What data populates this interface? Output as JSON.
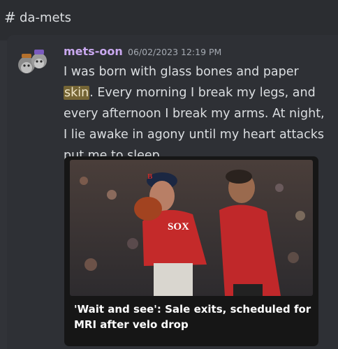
{
  "channel": {
    "hash": "#",
    "name": "da-mets"
  },
  "message": {
    "author": "mets-oon",
    "timestamp": "06/02/2023 12:19 PM",
    "text_before": "I was born with glass bones and paper ",
    "highlighted_word": "skin",
    "text_after": ". Every morning I break my legs, and every afternoon I break my arms. At night, I lie awake in agony until my heart attacks put me to sleep.",
    "embed": {
      "title": "'Wait and see': Sale exits, scheduled for MRI after velo drop",
      "image_logo": "B",
      "jersey_text": "SOX"
    }
  }
}
